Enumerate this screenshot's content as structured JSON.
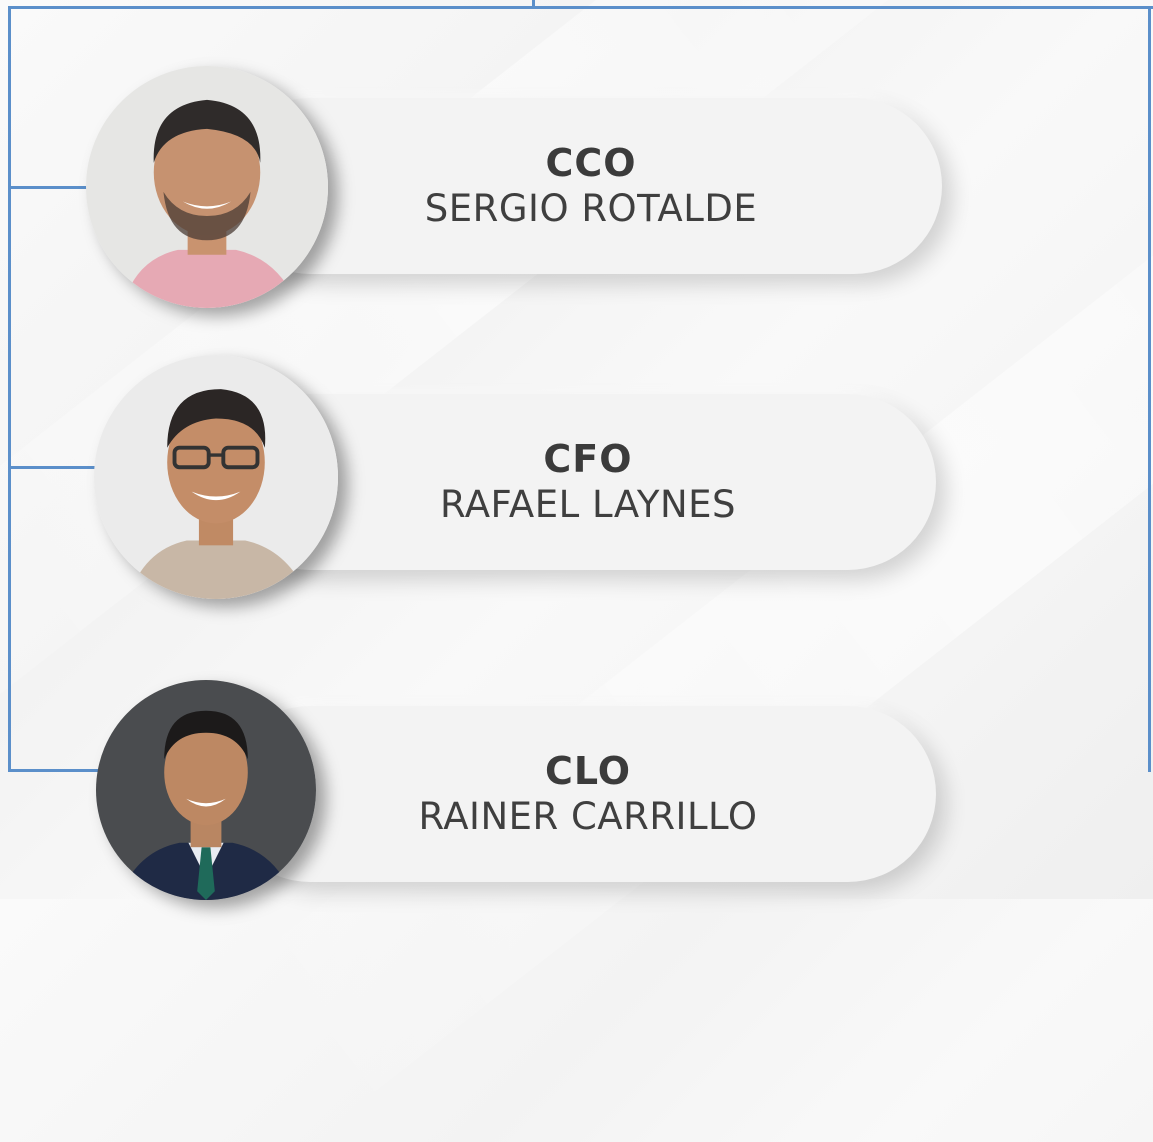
{
  "colors": {
    "connector": "#5b8fca",
    "pill_bg": "#f3f3f3",
    "text": "#3b3b3b"
  },
  "members": [
    {
      "role": "CCO",
      "name": "SERGIO ROTALDE",
      "avatar_icon": "person-photo-pink-shirt"
    },
    {
      "role": "CFO",
      "name": "RAFAEL LAYNES",
      "avatar_icon": "person-photo-glasses"
    },
    {
      "role": "CLO",
      "name": "RAINER CARRILLO",
      "avatar_icon": "person-photo-suit"
    }
  ]
}
